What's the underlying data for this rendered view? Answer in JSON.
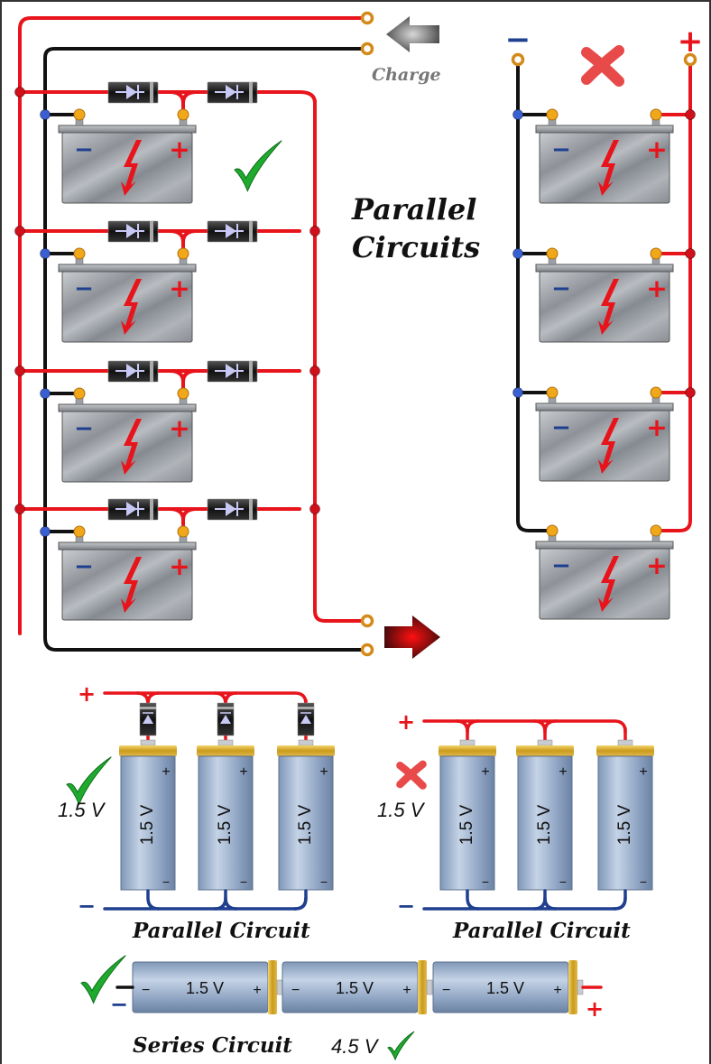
{
  "title": {
    "line1": "Parallel",
    "line2": "Circuits"
  },
  "charge_label": "Charge",
  "colors": {
    "positive_wire": "#e8141b",
    "negative_wire": "#111111",
    "negative_blue": "#1f3f8f",
    "check": "#1faa2e",
    "cross": "#e84a4a",
    "battery_body": "#9a9ea3"
  },
  "left_diagram": {
    "status": "check",
    "battery_count": 4,
    "battery_minus": "−",
    "battery_plus": "+",
    "diodes_per_row": 2
  },
  "right_diagram": {
    "status": "cross",
    "terminal_minus": "−",
    "terminal_plus": "+",
    "battery_count": 4,
    "battery_minus": "−",
    "battery_plus": "+"
  },
  "parallel_with_diodes": {
    "status": "check",
    "voltage_label": "1.5 V",
    "plus": "+",
    "minus": "−",
    "cells": [
      "1.5 V",
      "1.5 V",
      "1.5 V"
    ],
    "caption": "Parallel Circuit"
  },
  "parallel_without_diodes": {
    "status": "cross",
    "voltage_label": "1.5 V",
    "plus": "+",
    "minus": "−",
    "cells": [
      "1.5 V",
      "1.5 V",
      "1.5 V"
    ],
    "caption": "Parallel Circuit"
  },
  "series": {
    "status": "check",
    "cells": [
      "1.5 V",
      "1.5 V",
      "1.5 V"
    ],
    "cell_minus": "−",
    "cell_plus": "+",
    "plus": "+",
    "minus": "−",
    "caption": "Series Circuit",
    "total_voltage": "4.5 V"
  }
}
